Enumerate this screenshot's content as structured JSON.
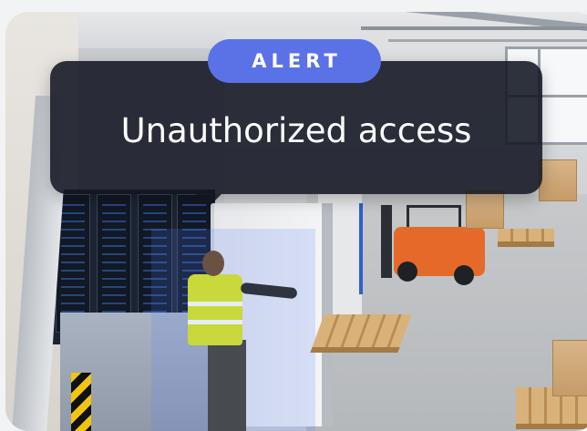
{
  "alert": {
    "badge_label": "ALERT",
    "message": "Unauthorized access"
  },
  "colors": {
    "badge": "#5a72e6",
    "overlay": "#121622",
    "text": "#ffffff"
  }
}
